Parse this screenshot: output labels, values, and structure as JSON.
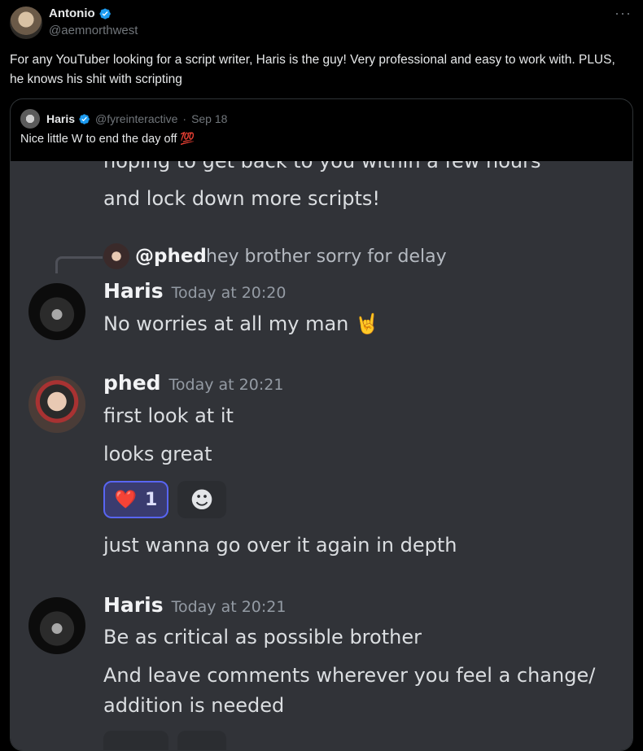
{
  "tweet": {
    "author_name": "Antonio",
    "author_handle": "@aemnorthwest",
    "more_icon": "···",
    "text": "For any YouTuber looking for a script writer, Haris is the guy! Very professional and easy to work with. PLUS, he knows his shit with scripting"
  },
  "quote": {
    "author_name": "Haris",
    "author_handle": "@fyreinteractive",
    "separator": "·",
    "date": "Sep 18",
    "text": "Nice little W to end the day off 💯"
  },
  "discord": {
    "partial_line": "hoping to get back to you within a few hours",
    "line_lock": "and lock down more scripts!",
    "reply_user": "@phed",
    "reply_text": "hey brother sorry for delay",
    "messages": [
      {
        "author": "Haris",
        "time": "Today at 20:20",
        "lines": [
          "No worries at all my man 🤘"
        ]
      },
      {
        "author": "phed",
        "time": "Today at 20:21",
        "lines": [
          "first look at it",
          "looks great",
          "just wanna go over it again in depth"
        ]
      },
      {
        "author": "Haris",
        "time": "Today at 20:21",
        "lines": [
          "Be as critical as possible brother",
          "And leave comments wherever you feel a change/",
          "addition is needed"
        ]
      }
    ],
    "reaction": {
      "emoji": "❤️",
      "count": "1"
    },
    "add_reaction_icon": "☻"
  },
  "colors": {
    "verified": "#1d9bf0",
    "discord_bg": "#313338",
    "reaction_border": "#5865f2"
  }
}
